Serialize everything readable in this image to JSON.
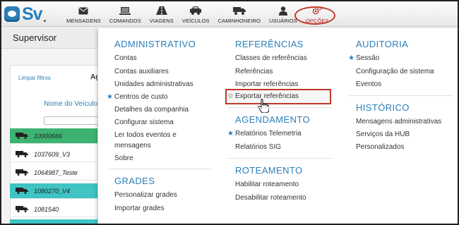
{
  "logo": {
    "text": "Sv",
    "caret": "▾"
  },
  "nav": [
    {
      "label": "MENSAGENS",
      "icon": "envelope-icon"
    },
    {
      "label": "COMANDOS",
      "icon": "laptop-icon"
    },
    {
      "label": "VIAGENS",
      "icon": "road-icon"
    },
    {
      "label": "VEÍCULOS",
      "icon": "car-icon"
    },
    {
      "label": "CAMINHONEIRO",
      "icon": "truck-icon"
    },
    {
      "label": "USUÁRIOS",
      "icon": "user-icon"
    },
    {
      "label": "OPÇÕES",
      "icon": "gears-icon"
    }
  ],
  "page": {
    "title": "Supervisor",
    "clear_filters": "Limpar filtros",
    "column_truncated": "Ag",
    "vehicle_column": "Nome do Veículo"
  },
  "vehicles": [
    {
      "id": "10000666",
      "status": "green"
    },
    {
      "id": "1037609_V3",
      "status": "none"
    },
    {
      "id": "1064987_Teste",
      "status": "none"
    },
    {
      "id": "1080270_V4",
      "status": "teal"
    },
    {
      "id": "1081540",
      "status": "none"
    }
  ],
  "menu": {
    "administrativo": {
      "title": "ADMINISTRATIVO",
      "items": [
        "Contas",
        "Contas auxiliares",
        "Unidades administrativas",
        "Centros de custo",
        "Detalhes da companhia",
        "Configurar sistema",
        "Ler todos eventos e",
        "mensagens",
        "Sobre"
      ]
    },
    "grades": {
      "title": "GRADES",
      "items": [
        "Personalizar grades",
        "Importar grades"
      ]
    },
    "referencias": {
      "title": "REFERÊNCIAS",
      "items": [
        "Classes de referências",
        "Referências",
        "Importar referências",
        "Exportar referências"
      ]
    },
    "agendamento": {
      "title": "AGENDAMENTO",
      "items": [
        "Relatórios Telemetria",
        "Relatórios SIG"
      ]
    },
    "roteamento": {
      "title": "ROTEAMENTO",
      "items": [
        "Habilitar roteamento",
        "Desabilitar roteamento"
      ]
    },
    "auditoria": {
      "title": "AUDITORIA",
      "items": [
        "Sessão",
        "Configuração de sistema",
        "Eventos"
      ]
    },
    "historico": {
      "title": "HISTÓRICO",
      "items": [
        "Mensagens administrativas",
        "Serviços da HUB",
        "Personalizados"
      ]
    }
  },
  "colors": {
    "accent": "#2a7fb8",
    "highlight": "#c0392b",
    "green_row": "#3cb371",
    "teal_row": "#3fc3c3"
  }
}
